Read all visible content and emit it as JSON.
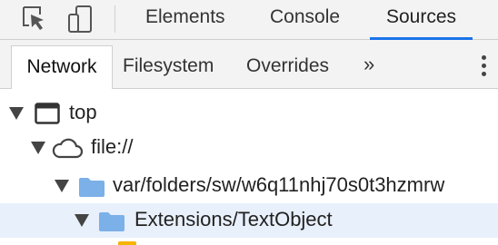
{
  "toolbar": {
    "icons": [
      "inspect-element-icon",
      "device-toolbar-icon"
    ],
    "tabs": [
      {
        "label": "Elements"
      },
      {
        "label": "Console"
      },
      {
        "label": "Sources",
        "active": true
      }
    ]
  },
  "navigator": {
    "tabs": [
      {
        "label": "Network",
        "active": true
      },
      {
        "label": "Filesystem"
      },
      {
        "label": "Overrides"
      }
    ],
    "more_label": "»",
    "menu_icon": "kebab-menu-icon"
  },
  "tree": {
    "nodes": [
      {
        "label": "top",
        "icon": "frame-icon",
        "expanded": true
      },
      {
        "label": "file://",
        "icon": "cloud-icon",
        "expanded": true
      },
      {
        "label": "var/folders/sw/w6q11nhj70s0t3hzmrw",
        "icon": "folder-icon",
        "expanded": true
      },
      {
        "label": "Extensions/TextObject",
        "icon": "folder-icon",
        "expanded": true,
        "selected": true
      }
    ]
  },
  "colors": {
    "accent": "#1a73e8",
    "folder": "#7cb0e8",
    "selected_row": "#e8f0fb",
    "toolbar_bg": "#f3f3f3",
    "file_icon": "#f5b400"
  }
}
